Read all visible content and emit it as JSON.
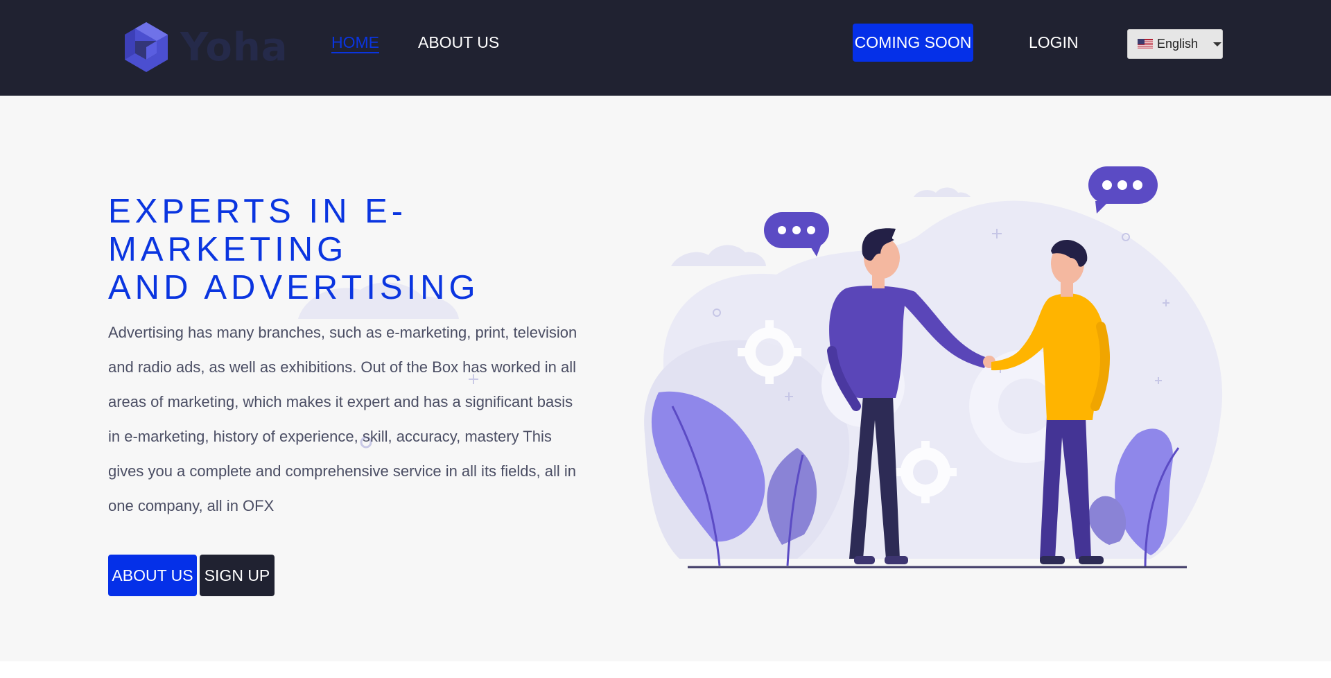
{
  "brand": {
    "name": "Yoha"
  },
  "nav": {
    "home": "HOME",
    "about": "ABOUT US",
    "coming_soon": "COMING SOON",
    "login": "LOGIN",
    "language": {
      "selected": "English",
      "flag_icon": "us-flag-icon"
    }
  },
  "hero": {
    "title_line1": "EXPERTS IN E-MARKETING",
    "title_line2": "AND ADVERTISING",
    "text": "Advertising has many branches, such as e-marketing, print, television and radio ads, as well as exhibitions. Out of the Box has worked in all areas of marketing, which makes it expert and has a significant basis in e-marketing, history of experience, skill, accuracy, mastery This gives you a complete and comprehensive service in all its fields, all in one company, all in OFX",
    "about_button": "ABOUT US",
    "signup_button": "SIGN UP"
  },
  "colors": {
    "navbar_bg": "#202231",
    "accent": "#0530e8",
    "hero_bg": "#f7f7f7",
    "text": "#4a4d63",
    "illustration_purple": "#5b4bc4",
    "illustration_yellow": "#ffb400"
  }
}
